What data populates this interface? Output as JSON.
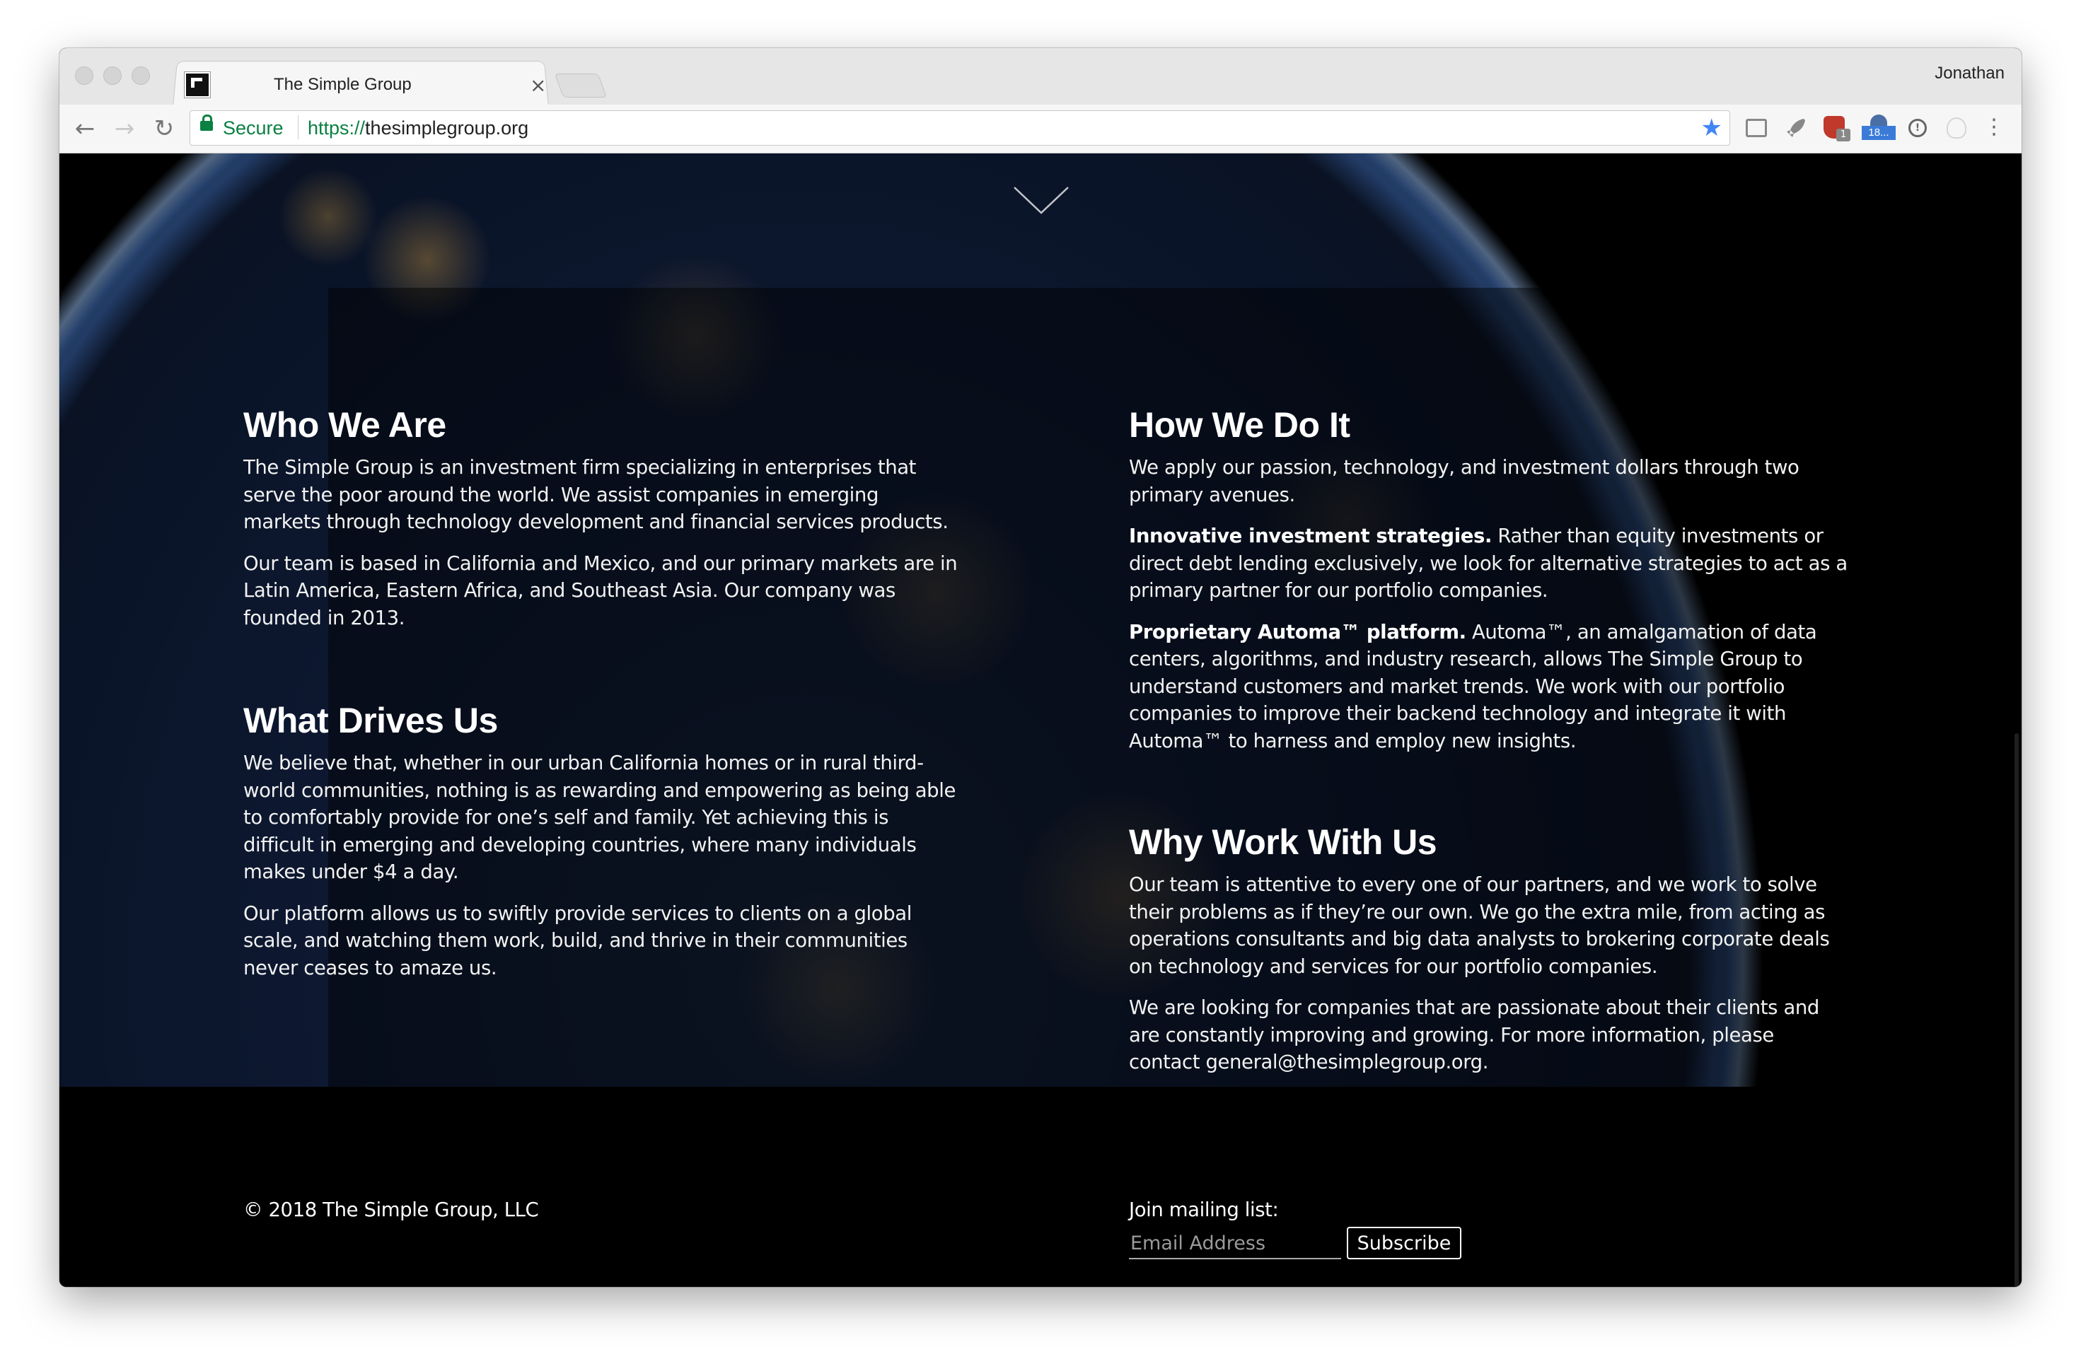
{
  "browser": {
    "tab_title": "The Simple Group",
    "tab_close": "×",
    "profile_name": "Jonathan",
    "secure_label": "Secure",
    "url_scheme": "https://",
    "url_host": "thesimplegroup.org",
    "bookmark_star": "★",
    "ext_badge_count": "1",
    "ext_badge_text": "18...",
    "menu_glyph": "⋮",
    "nav": {
      "back": "←",
      "forward": "→",
      "reload": "↻"
    }
  },
  "page": {
    "sections_left": [
      {
        "heading": "Who We Are",
        "paragraphs": [
          "The Simple Group is an investment firm specializing in enterprises that serve the poor around the world. We assist companies in emerging markets through technology development and financial services products.",
          "Our team is based in California and Mexico, and our primary markets are in Latin America, Eastern Africa, and Southeast Asia. Our company was founded in 2013."
        ]
      },
      {
        "heading": "What Drives Us",
        "paragraphs": [
          "We believe that, whether in our urban California homes or in rural third-world communities, nothing is as rewarding and empowering as being able to comfortably provide for one’s self and family. Yet achieving this is difficult in emerging and developing countries, where many individuals makes under $4 a day.",
          "Our platform allows us to swiftly provide services to clients on a global scale, and watching them work, build, and thrive in their communities never ceases to amaze us."
        ]
      }
    ],
    "sections_right": [
      {
        "heading": "How We Do It",
        "intro": "We apply our passion, technology, and investment dollars through two primary avenues.",
        "items": [
          {
            "lead": "Innovative investment strategies.",
            "text": " Rather than equity investments or direct debt lending exclusively, we look for alternative strategies to act as a primary partner for our portfolio companies."
          },
          {
            "lead": "Proprietary Automa™ platform.",
            "text": " Automa™, an amalgamation of data centers, algorithms, and industry research, allows The Simple Group to understand customers and market trends. We work with our portfolio companies to improve their backend technology and integrate it with Automa™ to harness and employ new insights."
          }
        ]
      },
      {
        "heading": "Why Work With Us",
        "paragraphs": [
          "Our team is attentive to every one of our partners, and we work to solve their problems as if they’re our own. We go the extra mile, from acting as operations consultants and big data analysts to brokering corporate deals on technology and services for our portfolio companies.",
          "We are looking for companies that are passionate about their clients and are constantly improving and growing. For more information, please contact general@thesimplegroup.org."
        ]
      }
    ],
    "footer": {
      "copyright": "© 2018 The Simple Group, LLC",
      "mailing_label": "Join mailing list:",
      "email_placeholder": "Email Address",
      "subscribe_label": "Subscribe"
    }
  },
  "colors": {
    "secure_green": "#0b8043",
    "star_blue": "#4285f4",
    "page_background": "#000000",
    "text": "#ffffff"
  },
  "icons": [
    "lock-icon",
    "star-icon",
    "scroll-down-chevron-icon",
    "favicon"
  ]
}
